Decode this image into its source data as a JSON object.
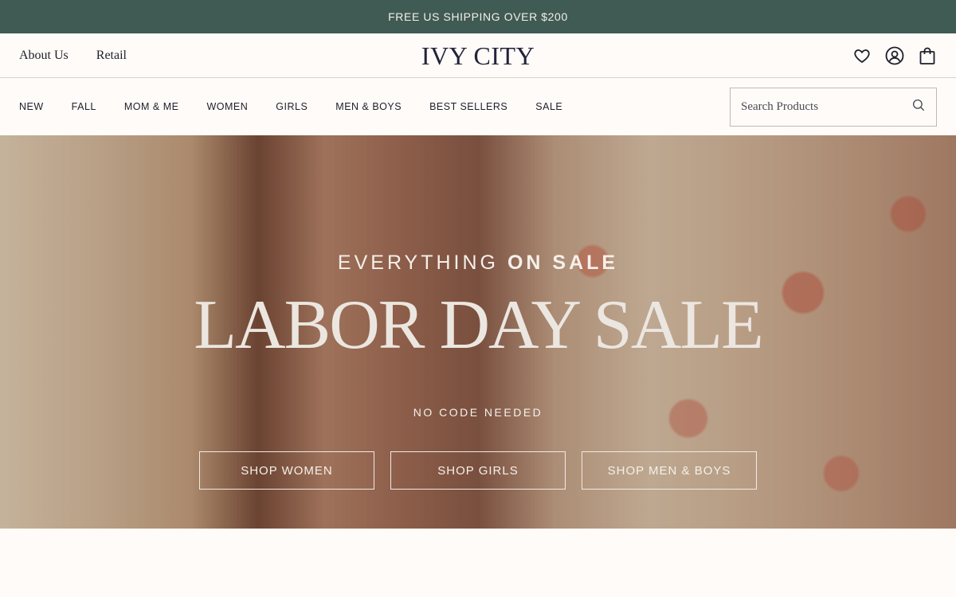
{
  "announcement": "FREE US SHIPPING OVER $200",
  "header": {
    "links": [
      "About Us",
      "Retail"
    ],
    "logo": "IVY CITY",
    "icons": [
      "heart-icon",
      "user-icon",
      "bag-icon"
    ]
  },
  "nav": {
    "items": [
      "NEW",
      "FALL",
      "MOM & ME",
      "WOMEN",
      "GIRLS",
      "MEN & BOYS",
      "BEST SELLERS",
      "SALE"
    ],
    "search_placeholder": "Search Products"
  },
  "hero": {
    "eyebrow_light": "EVERYTHING",
    "eyebrow_bold": "ON SALE",
    "headline": "LABOR DAY SALE",
    "subline": "NO CODE NEEDED",
    "buttons": [
      "SHOP WOMEN",
      "SHOP GIRLS",
      "SHOP MEN & BOYS"
    ]
  },
  "colors": {
    "announcement_bg": "#3f5b53",
    "page_bg": "#fffbf8",
    "text": "#1f1f2b"
  }
}
